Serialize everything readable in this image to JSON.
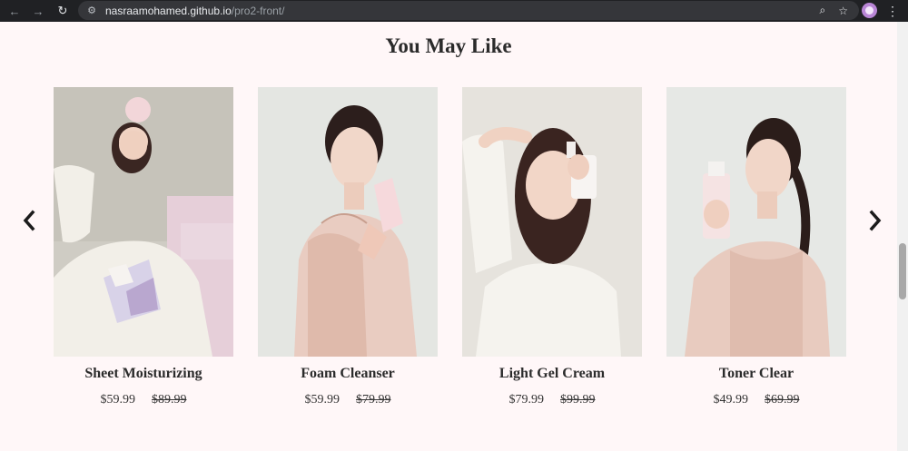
{
  "browser": {
    "url_host": "nasraamohamed.github.io",
    "url_path": "/pro2-front/"
  },
  "section": {
    "title": "You May Like"
  },
  "products": [
    {
      "name": "Sheet Moisturizing",
      "price": "$59.99",
      "old_price": "$89.99"
    },
    {
      "name": "Foam Cleanser",
      "price": "$59.99",
      "old_price": "$79.99"
    },
    {
      "name": "Light Gel Cream",
      "price": "$79.99",
      "old_price": "$99.99"
    },
    {
      "name": "Toner Clear",
      "price": "$49.99",
      "old_price": "$69.99"
    }
  ],
  "icons": {
    "back": "back-arrow-icon",
    "forward": "forward-arrow-icon",
    "reload": "reload-icon",
    "site_info": "tune-icon",
    "zoom": "zoom-icon",
    "bookmark": "star-icon",
    "menu": "kebab-menu-icon",
    "prev": "chevron-left-icon",
    "next": "chevron-right-icon"
  }
}
